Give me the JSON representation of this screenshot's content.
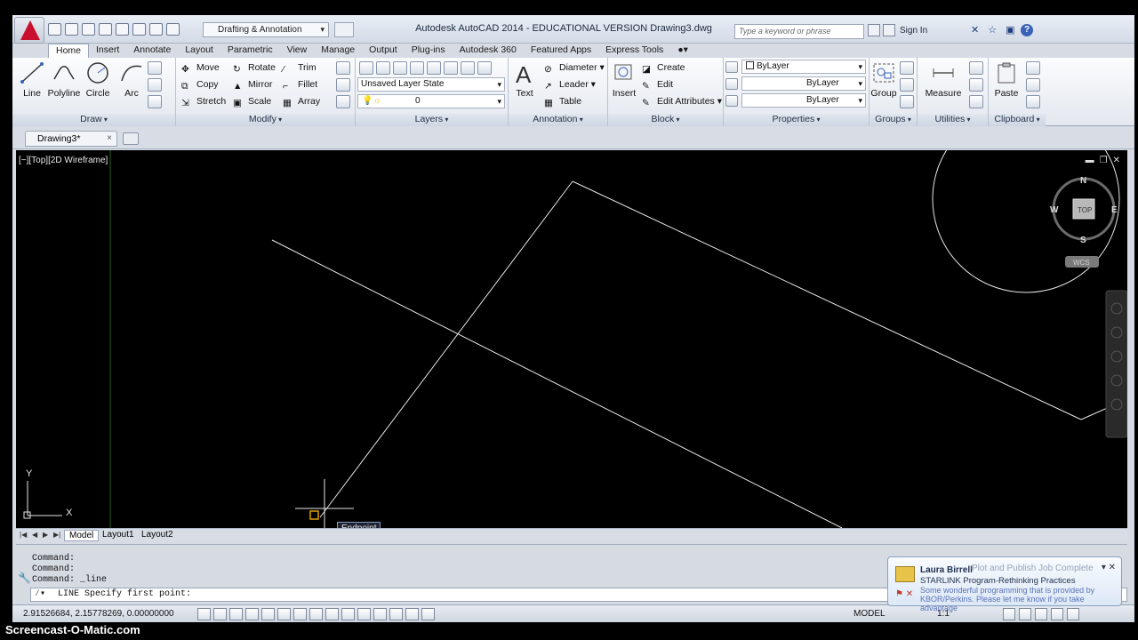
{
  "window": {
    "title": "Autodesk AutoCAD 2014 - EDUCATIONAL VERSION    Drawing3.dwg",
    "workspace": "Drafting & Annotation",
    "search_placeholder": "Type a keyword or phrase",
    "sign_in": "Sign In",
    "help": "?"
  },
  "ribbon_tabs": [
    "Home",
    "Insert",
    "Annotate",
    "Layout",
    "Parametric",
    "View",
    "Manage",
    "Output",
    "Plug-ins",
    "Autodesk 360",
    "Featured Apps",
    "Express Tools"
  ],
  "ribbon": {
    "draw": {
      "title": "Draw",
      "line": "Line",
      "polyline": "Polyline",
      "circle": "Circle",
      "arc": "Arc"
    },
    "modify": {
      "title": "Modify",
      "move": "Move",
      "rotate": "Rotate",
      "trim": "Trim",
      "copy": "Copy",
      "mirror": "Mirror",
      "fillet": "Fillet",
      "stretch": "Stretch",
      "scale": "Scale",
      "array": "Array"
    },
    "layers": {
      "title": "Layers",
      "layer_state": "Unsaved Layer State",
      "current_layer": "0"
    },
    "annotation": {
      "title": "Annotation",
      "text": "Text",
      "diameter": "Diameter",
      "leader": "Leader",
      "table": "Table"
    },
    "block": {
      "title": "Block",
      "insert": "Insert",
      "create": "Create",
      "edit": "Edit",
      "edit_attributes": "Edit Attributes"
    },
    "properties": {
      "title": "Properties",
      "color": "ByLayer",
      "linetype": "ByLayer",
      "lineweight": "ByLayer"
    },
    "groups": {
      "title": "Groups",
      "group": "Group"
    },
    "utilities": {
      "title": "Utilities",
      "measure": "Measure"
    },
    "clipboard": {
      "title": "Clipboard",
      "paste": "Paste"
    }
  },
  "file_tab": {
    "name": "Drawing3*",
    "close": "×"
  },
  "viewport": {
    "label": "[−][Top][2D Wireframe]",
    "compass": {
      "n": "N",
      "s": "S",
      "e": "E",
      "w": "W",
      "top": "TOP",
      "ucs": "WCS"
    },
    "ucs_y": "Y",
    "ucs_x": "X",
    "osnap_tooltip": "Endpoint"
  },
  "layout_tabs": [
    "Model",
    "Layout1",
    "Layout2"
  ],
  "command": {
    "history": [
      "Command:",
      "Command:",
      "Command:  _line"
    ],
    "prompt": "LINE Specify first point:"
  },
  "status": {
    "coords": "2.91526684, 2.15778269, 0.00000000",
    "model": "MODEL",
    "scale": "1:1"
  },
  "notification": {
    "from": "Laura Birrell",
    "background_title": "Plot and Publish Job Complete",
    "subject": "STARLINK Program-Rethinking Practices",
    "body": "Some wonderful programming that is provided by KBOR/Perkins. Please let me know if you take advantage"
  },
  "watermark": "Screencast-O-Matic.com",
  "colors": {
    "canvas": "#000000",
    "lines": "#e6e6e6",
    "logo": "#c8102e"
  }
}
